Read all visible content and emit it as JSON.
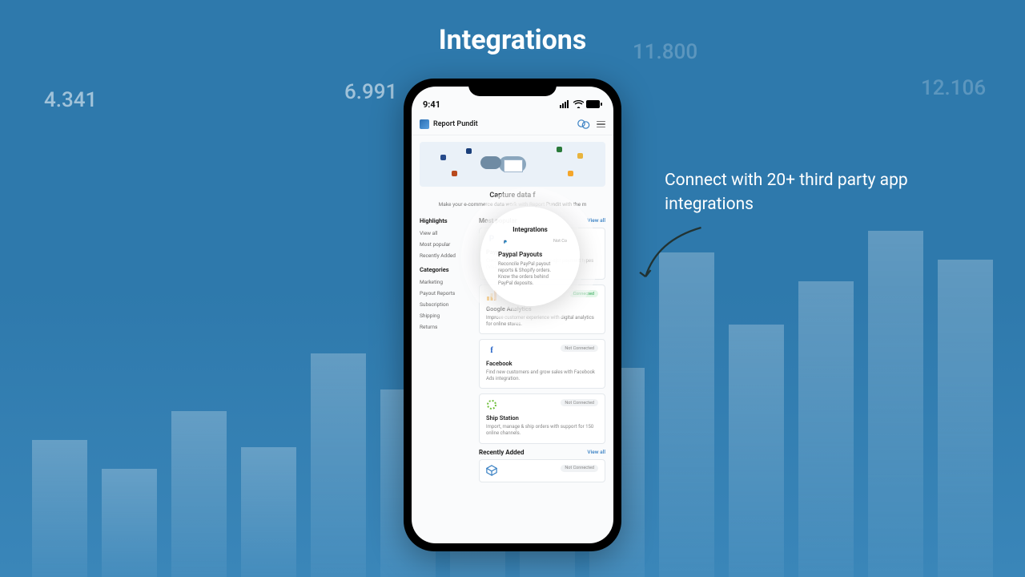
{
  "page_title": "Integrations",
  "callout_text": "Connect with 20+ third party app integrations",
  "bg_numbers": [
    "4.341",
    "6.991",
    "11.800",
    "12.106"
  ],
  "phone": {
    "status_time": "9:41",
    "app_name": "Report Pundit",
    "hero_caption_prefix": "Capture data f",
    "hero_caption_suffix": "Integrations",
    "hero_sub": "Make your e-commerce data work with Report Pundit with the m",
    "sidebar": {
      "highlights_label": "Highlights",
      "highlights": [
        "View all",
        "Most popular",
        "Recently Added"
      ],
      "categories_label": "Categories",
      "categories": [
        "Marketing",
        "Payout Reports",
        "Subscription",
        "Shipping",
        "Returns"
      ]
    },
    "sections": {
      "popular": {
        "label": "Most popular",
        "view_all": "View all"
      },
      "recent": {
        "label": "Recently Added",
        "view_all": "View all"
      }
    },
    "cards": [
      {
        "icon": "paypal",
        "title": "Paypal Payouts",
        "status": "Not Connected",
        "status_ok": false,
        "desc": "Credit card processing for all major payment types (Visa, Mastercard, etc)."
      },
      {
        "icon": "ga",
        "title": "Google Analytics",
        "status": "Connected",
        "status_ok": true,
        "desc": "Improve customer experience with digital analytics for online stores."
      },
      {
        "icon": "fb",
        "title": "Facebook",
        "status": "Not Connected",
        "status_ok": false,
        "desc": "Find new customers and grow sales with Facebook Ads integration."
      },
      {
        "icon": "shipstation",
        "title": "Ship Station",
        "status": "Not Connected",
        "status_ok": false,
        "desc": "Import, manage & ship orders with support for 150 online channels."
      }
    ],
    "recent_card": {
      "icon": "box",
      "status": "Not Connected"
    },
    "halo": {
      "section_label": "Integrations",
      "status": "Not Co",
      "title": "Paypal Payouts",
      "desc": "Reconcile PayPal payout reports & Shopify orders. Know the orders behind PayPal deposits."
    }
  }
}
